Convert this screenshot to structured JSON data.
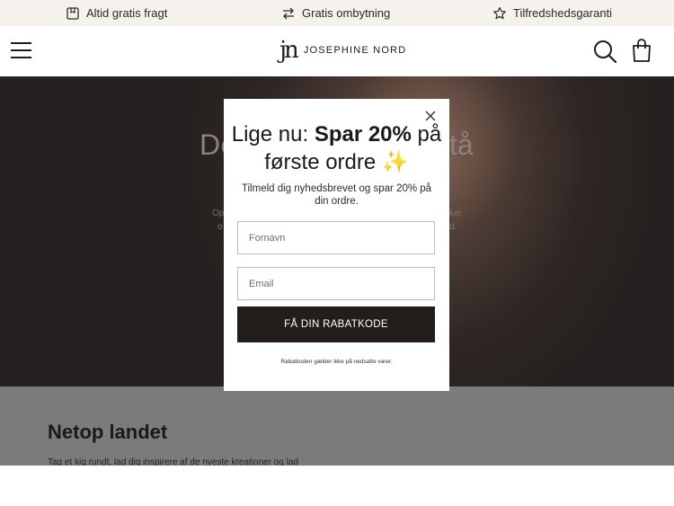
{
  "topbar": {
    "perks": [
      {
        "icon": "box-icon",
        "label": "Altid gratis fragt"
      },
      {
        "icon": "exchange-icon",
        "label": "Gratis ombytning"
      },
      {
        "icon": "star-icon",
        "label": "Tilfredshedsgaranti"
      }
    ]
  },
  "header": {
    "logo_mark": "jn",
    "logo_text": "JOSEPHINE NORD"
  },
  "hero": {
    "title_left": "De",
    "title_right": "tå",
    "text_left_1": "Op",
    "text_left_2": "o",
    "text_right_1": "ker",
    "text_right_2": "d."
  },
  "section": {
    "title": "Netop landet",
    "subtitle": "Tag et kig rundt, lad dig inspirere af de nyeste kreationer og lad"
  },
  "modal": {
    "heading_prefix": "Lige nu: ",
    "heading_bold": "Spar 20%",
    "heading_suffix": " på første ordre",
    "heading_emoji": "✨",
    "subtext": "Tilmeld dig nyhedsbrevet og spar 20% på din ordre.",
    "firstname_placeholder": "Fornavn",
    "firstname_value": "",
    "email_placeholder": "Email",
    "email_value": "",
    "cta_label": "FÅ DIN RABATKODE",
    "disclaimer": "Rabatkoden gælder ikke på nedsatte varer."
  },
  "colors": {
    "topbar_bg": "#f5f1ec",
    "cta_bg": "#231d1b",
    "section_bg": "#7b7b7b"
  }
}
